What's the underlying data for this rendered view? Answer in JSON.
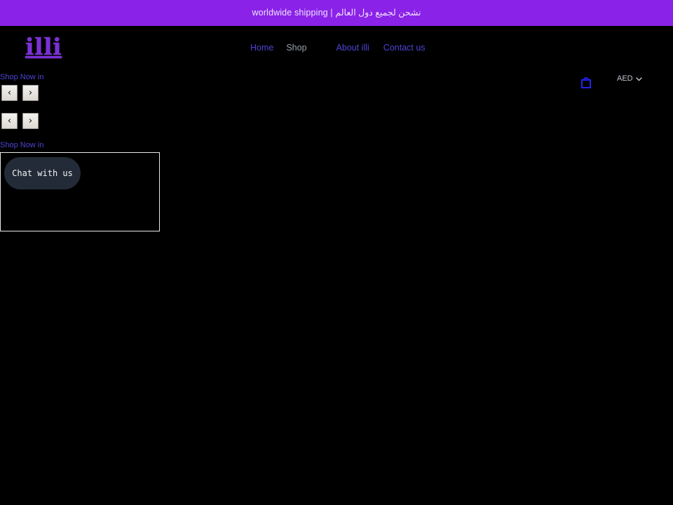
{
  "announcement": {
    "text": "worldwide shipping | نشحن لجميع دول العالم",
    "background": "#8b22e8",
    "text_color": "#efe4fb"
  },
  "header": {
    "logo": "illi",
    "logo_color": "#7b30d8",
    "nav": [
      {
        "label": "Home",
        "current": false
      },
      {
        "label": "Shop",
        "current": true
      },
      {
        "label": "About illi",
        "current": false
      },
      {
        "label": "Contact us",
        "current": false
      }
    ],
    "cart": {
      "icon": "shopping-bag-icon",
      "color": "#2222ee"
    },
    "currency": {
      "value": "AED",
      "icon": "chevron-down-icon",
      "color": "#bfc4cc"
    }
  },
  "main": {
    "blocks": [
      {
        "label": "Shop Now in",
        "prev_label": "‹",
        "next_label": "›"
      },
      {
        "label": "Shop Now in",
        "prev_label": "‹",
        "next_label": "›"
      }
    ],
    "link_color": "#4e43d6"
  },
  "chat_widget": {
    "button_label": "Chat with us",
    "button_background": "#242b38",
    "button_text_color": "#f2f4f7",
    "frame_border_color": "#e8e8e8"
  },
  "page": {
    "background": "#000000"
  }
}
